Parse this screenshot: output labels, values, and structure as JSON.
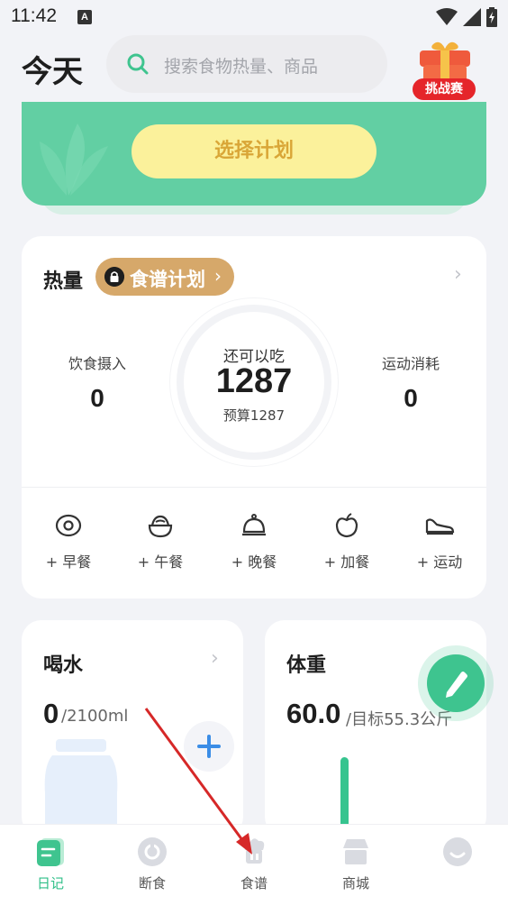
{
  "status_bar": {
    "time": "11:42",
    "notification_badge": "A"
  },
  "header": {
    "title": "今天",
    "search_placeholder": "搜索食物热量、商品",
    "challenge_badge": "挑战赛"
  },
  "banner": {
    "button_label": "选择计划"
  },
  "calories": {
    "title": "热量",
    "plan_pill": "食谱计划",
    "intake_label": "饮食摄入",
    "intake_value": "0",
    "remaining_label": "还可以吃",
    "remaining_value": "1287",
    "budget_text": "预算1287",
    "exercise_label": "运动消耗",
    "exercise_value": "0",
    "meals": [
      {
        "label": "+ 早餐",
        "icon": "breakfast-icon"
      },
      {
        "label": "+ 午餐",
        "icon": "lunch-icon"
      },
      {
        "label": "+ 晚餐",
        "icon": "dinner-icon"
      },
      {
        "label": "+ 加餐",
        "icon": "snack-icon"
      },
      {
        "label": "+ 运动",
        "icon": "exercise-icon"
      }
    ]
  },
  "water": {
    "title": "喝水",
    "value": "0",
    "unit": "/2100ml"
  },
  "weight": {
    "title": "体重",
    "value": "60.0",
    "unit": "/目标55.3公斤"
  },
  "bottom_nav": [
    {
      "label": "日记",
      "icon": "diary-icon",
      "active": true
    },
    {
      "label": "断食",
      "icon": "fasting-icon",
      "active": false
    },
    {
      "label": "食谱",
      "icon": "recipe-icon",
      "active": false
    },
    {
      "label": "商城",
      "icon": "shop-icon",
      "active": false
    },
    {
      "label": "",
      "icon": "profile-icon",
      "active": false
    }
  ],
  "colors": {
    "brand_green": "#62cfa3",
    "plan_button_bg": "#fbf19b",
    "plan_button_text": "#d9a637",
    "plan_pill": "#d6a86a",
    "active_nav": "#2fbf88",
    "annotation_arrow": "#d62828"
  }
}
